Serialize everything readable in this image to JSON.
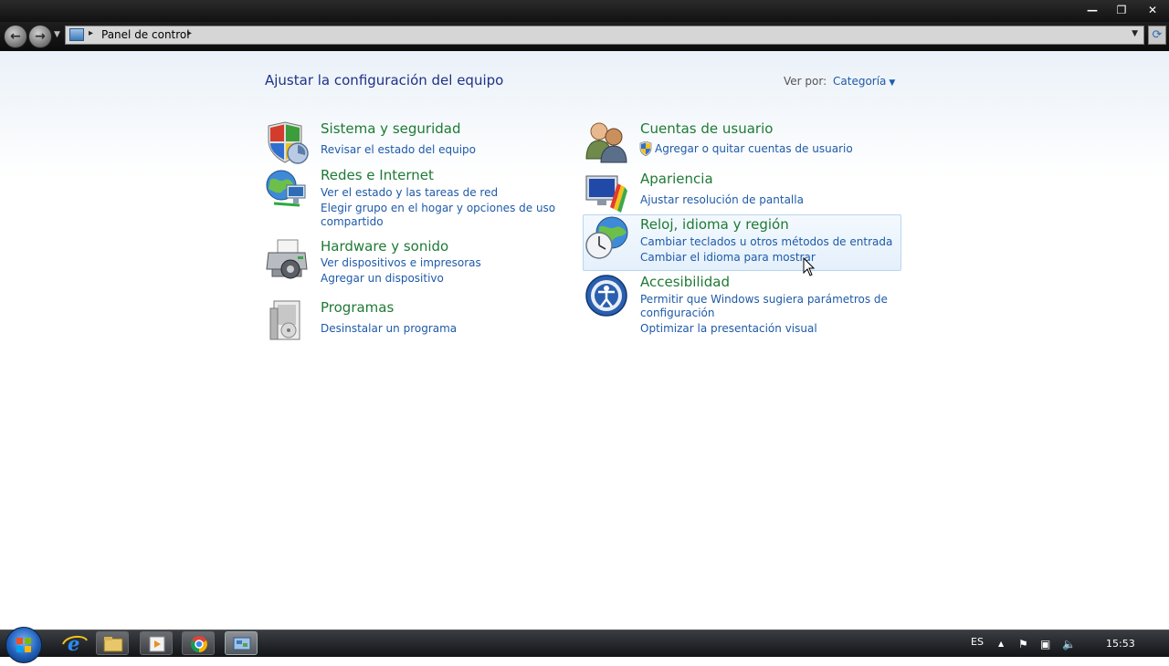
{
  "window": {
    "minimize_glyph": "—",
    "maximize_glyph": "❐",
    "close_glyph": "✕"
  },
  "address_bar": {
    "path": "Panel de control",
    "separator": "▸",
    "dropdown_glyph": "▼",
    "refresh_glyph": "⟳"
  },
  "header": {
    "title": "Ajustar la configuración del equipo",
    "view_by_label": "Ver por:",
    "view_by_value": "Categoría",
    "caret": "▼"
  },
  "categories_left": [
    {
      "title": "Sistema y seguridad",
      "icon": "shield-icon",
      "links": [
        "Revisar el estado del equipo"
      ]
    },
    {
      "title": "Redes e Internet",
      "icon": "network-globe-icon",
      "links": [
        "Ver el estado y las tareas de red",
        "Elegir grupo en el hogar y opciones de uso",
        "compartido"
      ]
    },
    {
      "title": "Hardware y sonido",
      "icon": "printer-icon",
      "links": [
        "Ver dispositivos e impresoras",
        "Agregar un dispositivo"
      ]
    },
    {
      "title": "Programas",
      "icon": "programs-icon",
      "links": [
        "Desinstalar un programa"
      ]
    }
  ],
  "categories_right": [
    {
      "title": "Cuentas de usuario",
      "icon": "users-icon",
      "links": [
        "Agregar o quitar cuentas de usuario"
      ]
    },
    {
      "title": "Apariencia",
      "icon": "appearance-icon",
      "links": [
        "Ajustar resolución de pantalla"
      ]
    },
    {
      "title": "Reloj, idioma y región",
      "icon": "clock-globe-icon",
      "links": [
        "Cambiar teclados u otros métodos de entrada",
        "Cambiar el idioma para mostrar"
      ]
    },
    {
      "title": "Accesibilidad",
      "icon": "accessibility-icon",
      "links": [
        "Permitir que Windows sugiera parámetros de",
        "configuración",
        "Optimizar la presentación visual"
      ]
    }
  ],
  "taskbar": {
    "language": "ES",
    "clock": "15:53",
    "tray_up_glyph": "▲",
    "pinned": [
      "internet-explorer-icon",
      "explorer-icon",
      "media-player-icon",
      "chrome-icon",
      "control-panel-icon"
    ]
  },
  "colors": {
    "link": "#1e5aa8",
    "category_title": "#1e7a35",
    "page_title": "#1e3287"
  }
}
